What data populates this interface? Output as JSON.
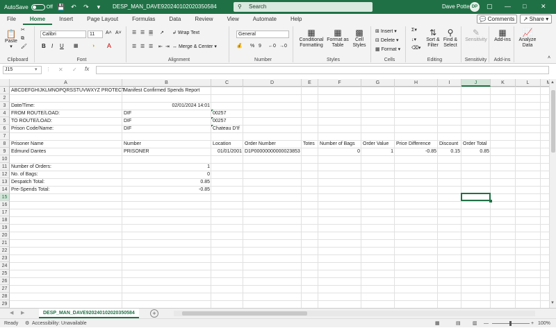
{
  "titlebar": {
    "autosave_label": "AutoSave",
    "autosave_state": "Off",
    "doc_title": "DESP_MAN_DAVE920240102020350584 - Read-...",
    "search_placeholder": "Search",
    "user_name": "Dave Potter",
    "user_initials": "DP"
  },
  "menu": {
    "tabs": [
      "File",
      "Home",
      "Insert",
      "Page Layout",
      "Formulas",
      "Data",
      "Review",
      "View",
      "Automate",
      "Help"
    ],
    "active": "Home",
    "comments_label": "Comments",
    "share_label": "Share"
  },
  "ribbon": {
    "clipboard": {
      "label": "Clipboard",
      "paste": "Paste"
    },
    "font": {
      "label": "Font",
      "family": "Calibri",
      "size": "11"
    },
    "alignment": {
      "label": "Alignment",
      "wrap": "Wrap Text",
      "merge": "Merge & Center"
    },
    "number": {
      "label": "Number",
      "format": "General"
    },
    "styles": {
      "label": "Styles",
      "conditional": "Conditional Formatting",
      "format_table": "Format as Table",
      "cell_styles": "Cell Styles"
    },
    "cells": {
      "label": "Cells",
      "insert": "Insert",
      "delete": "Delete",
      "format": "Format"
    },
    "editing": {
      "label": "Editing",
      "sort": "Sort & Filter",
      "find": "Find & Select"
    },
    "sensitivity": {
      "label": "Sensitivity",
      "button": "Sensitivity"
    },
    "addins": {
      "label": "Add-ins",
      "button": "Add-ins"
    },
    "analysis": {
      "button": "Analyze Data"
    }
  },
  "formula_bar": {
    "name_box": "J15",
    "fx": "fx",
    "content": ""
  },
  "columns": [
    "A",
    "B",
    "C",
    "D",
    "E",
    "F",
    "G",
    "H",
    "I",
    "J",
    "K",
    "L",
    "M"
  ],
  "selected_col": "J",
  "selected_row": 15,
  "rows": [
    1,
    2,
    3,
    4,
    5,
    6,
    7,
    8,
    9,
    10,
    11,
    12,
    13,
    14,
    15,
    16,
    17,
    18,
    19,
    20,
    21,
    22,
    23,
    24,
    25,
    26,
    27,
    28,
    29
  ],
  "cells": {
    "A1": "ABCDEFGHIJKLMNOPQRSSTUVWXYZ PROTECT",
    "B1": "Manifest Confirmed Spends Report",
    "A3": "Date/Time:",
    "B3": "02/01/2024 14:01",
    "A4": "FROM ROUTE/LOAD:",
    "B4": "DIF",
    "C4": "00257",
    "A5": "TO ROUTE/LOAD:",
    "B5": "DIF",
    "C5": "00257",
    "A6": "Prison Code/Name:",
    "B6": "DIF",
    "C6": "Chateau D'If",
    "A8": "Prisoner Name",
    "B8": "Number",
    "C8": "Location",
    "D8": "Order Number",
    "E8": "Totes",
    "F8": "Number of Bags",
    "G8": "Order Value",
    "H8": "Price Difference",
    "I8": "Discount",
    "J8": "Order Total",
    "A9": "Edmund Dantes",
    "B9": "PRISONER",
    "C9": "01/01/2001",
    "D9": "D1P00000000000023853",
    "F9": "0",
    "G9": "1",
    "H9": "-0.85",
    "I9": "0.15",
    "J9": "0.85",
    "A11": "Number of Orders:",
    "B11": "1",
    "A12": "No. of Bags:",
    "B12": "0",
    "A13": "Despatch Total:",
    "B13": "0.85",
    "A14": "Pre-Spends Total:",
    "B14": "-0.85"
  },
  "sheet": {
    "tab_name": "DESP_MAN_DAVE920240102020350584",
    "add": "+"
  },
  "status": {
    "ready": "Ready",
    "accessibility": "Accessibility: Unavailable",
    "zoom": "100%"
  }
}
